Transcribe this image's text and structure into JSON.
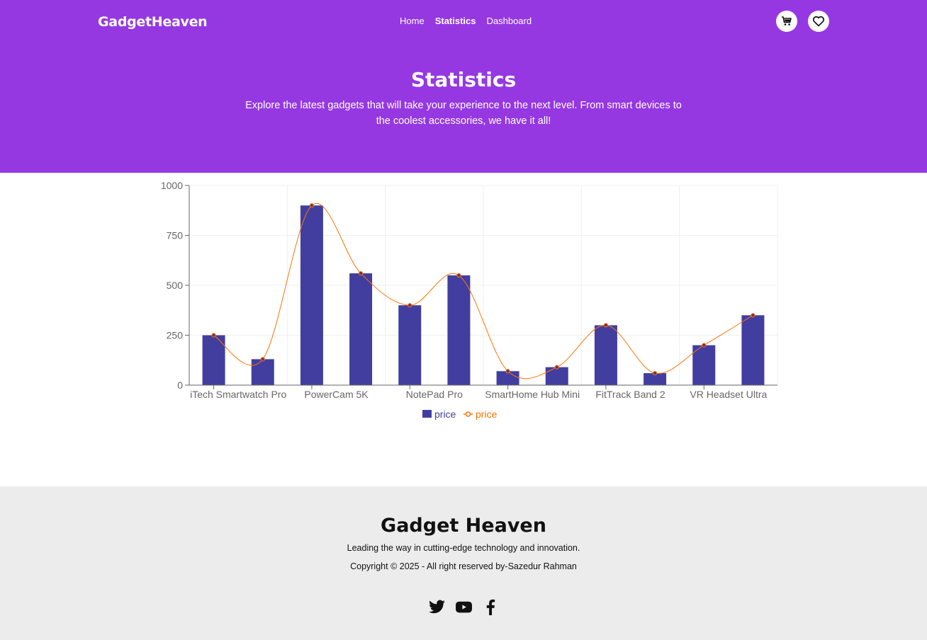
{
  "header": {
    "logo": "GadgetHeaven",
    "nav": [
      "Home",
      "Statistics",
      "Dashboard"
    ],
    "active_nav": "Statistics",
    "icons": [
      "cart-icon",
      "heart-icon"
    ]
  },
  "hero": {
    "title": "Statistics",
    "description": "Explore the latest gadgets that will take your experience to the next level. From smart devices to the coolest accessories, we have it all!"
  },
  "colors": {
    "brand": "#9538E2",
    "bar": "#413ea0",
    "line": "#ff7300",
    "footer_bg": "#ececec"
  },
  "chart_data": {
    "type": "bar",
    "categories": [
      "iTech Smartwatch Pro",
      "",
      "PowerCam 5K",
      "",
      "NotePad Pro",
      "",
      "SmartHome Hub Mini",
      "",
      "FitTrack Band 2",
      "",
      "VR Headset Ultra",
      ""
    ],
    "visible_x_ticks": [
      "iTech Smartwatch Pro",
      "PowerCam 5K",
      "NotePad Pro",
      "SmartHome Hub Mini",
      "FitTrack Band 2",
      "VR Headset Ultra"
    ],
    "series": [
      {
        "name": "price",
        "type": "bar",
        "values": [
          250,
          130,
          900,
          560,
          400,
          550,
          70,
          90,
          300,
          60,
          200,
          350
        ]
      },
      {
        "name": "price",
        "type": "line",
        "values": [
          250,
          130,
          900,
          560,
          400,
          550,
          70,
          90,
          300,
          60,
          200,
          350
        ]
      }
    ],
    "yticks": [
      0,
      250,
      500,
      750,
      1000
    ],
    "ylim": [
      0,
      1000
    ],
    "grid": true,
    "legend": "bottom-center"
  },
  "footer": {
    "title": "Gadget Heaven",
    "tagline": "Leading the way in cutting-edge technology and innovation.",
    "copyright": "Copyright © 2025 - All right reserved by-Sazedur Rahman",
    "social_icons": [
      "twitter-icon",
      "youtube-icon",
      "facebook-icon"
    ]
  }
}
